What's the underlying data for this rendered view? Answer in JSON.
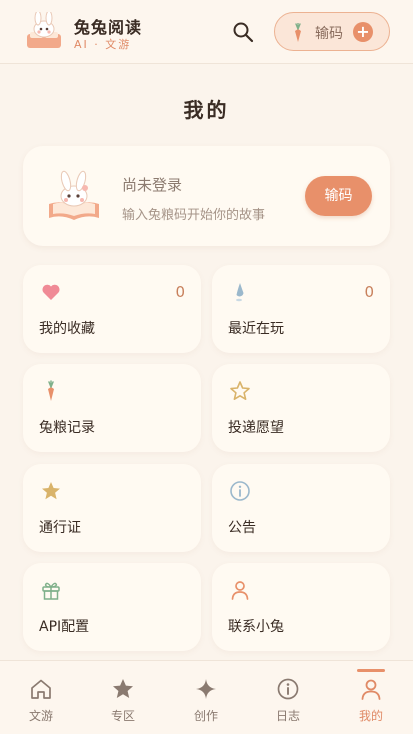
{
  "header": {
    "app_title": "兔兔阅读",
    "app_subtitle": "AI · 文游",
    "code_button_label": "输码",
    "search_icon": "search-icon",
    "plus_icon": "plus-icon"
  },
  "page": {
    "title": "我的"
  },
  "login_card": {
    "status": "尚未登录",
    "hint": "输入兔粮码开始你的故事",
    "button_label": "输码"
  },
  "tiles": [
    {
      "label": "我的收藏",
      "count": "0",
      "icon": "heart-icon"
    },
    {
      "label": "最近在玩",
      "count": "0",
      "icon": "drop-icon"
    },
    {
      "label": "兔粮记录",
      "icon": "carrot-icon"
    },
    {
      "label": "投递愿望",
      "icon": "star-outline-icon"
    },
    {
      "label": "通行证",
      "icon": "star-icon"
    },
    {
      "label": "公告",
      "icon": "info-icon"
    },
    {
      "label": "API配置",
      "icon": "gift-icon"
    },
    {
      "label": "联系小兔",
      "icon": "user-icon"
    }
  ],
  "tabbar": {
    "active": "我的",
    "tabs": [
      {
        "label": "文游",
        "icon": "home-icon"
      },
      {
        "label": "专区",
        "icon": "star-icon"
      },
      {
        "label": "创作",
        "icon": "sparkle-icon"
      },
      {
        "label": "日志",
        "icon": "info-icon"
      },
      {
        "label": "我的",
        "icon": "user-icon"
      }
    ]
  },
  "colors": {
    "accent": "#e8906a",
    "background": "#fbf4ec",
    "card": "#fffaf2",
    "heart": "#f08a96",
    "drop": "#9bb8cc",
    "star_gold": "#d9b36a",
    "gift_green": "#7fb08a"
  }
}
